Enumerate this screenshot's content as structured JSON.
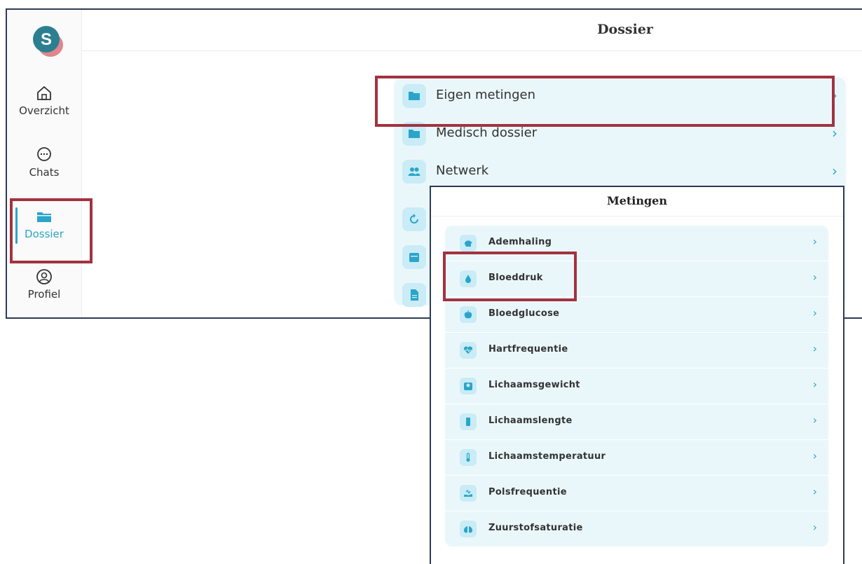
{
  "sidebar": {
    "items": [
      {
        "label": "Overzicht",
        "icon": "home-icon"
      },
      {
        "label": "Chats",
        "icon": "chat-icon"
      },
      {
        "label": "Dossier",
        "icon": "folder-icon",
        "active": true
      },
      {
        "label": "Profiel",
        "icon": "user-icon"
      }
    ]
  },
  "header": {
    "title": "Dossier"
  },
  "dossier_menu": {
    "items": [
      {
        "label": "Eigen metingen",
        "icon": "folder-icon"
      },
      {
        "label": "Medisch dossier",
        "icon": "folder-icon"
      },
      {
        "label": "Netwerk",
        "icon": "people-icon"
      },
      {
        "label": "",
        "icon": "refresh-icon"
      },
      {
        "label": "",
        "icon": "calendar-icon"
      },
      {
        "label": "",
        "icon": "document-icon"
      }
    ]
  },
  "metingen": {
    "title": "Metingen",
    "items": [
      {
        "label": "Ademhaling",
        "icon": "breathing-icon"
      },
      {
        "label": "Bloeddruk",
        "icon": "drop-icon"
      },
      {
        "label": "Bloedglucose",
        "icon": "apple-icon"
      },
      {
        "label": "Hartfrequentie",
        "icon": "heart-rate-icon"
      },
      {
        "label": "Lichaamsgewicht",
        "icon": "scale-icon"
      },
      {
        "label": "Lichaamslengte",
        "icon": "ruler-icon"
      },
      {
        "label": "Lichaamstemperatuur",
        "icon": "thermometer-icon"
      },
      {
        "label": "Polsfrequentie",
        "icon": "pulse-icon"
      },
      {
        "label": "Zuurstofsaturatie",
        "icon": "lungs-icon"
      }
    ]
  },
  "colors": {
    "accent": "#2aa5c9",
    "highlight": "#a3323f",
    "card": "#eaf7fa"
  }
}
